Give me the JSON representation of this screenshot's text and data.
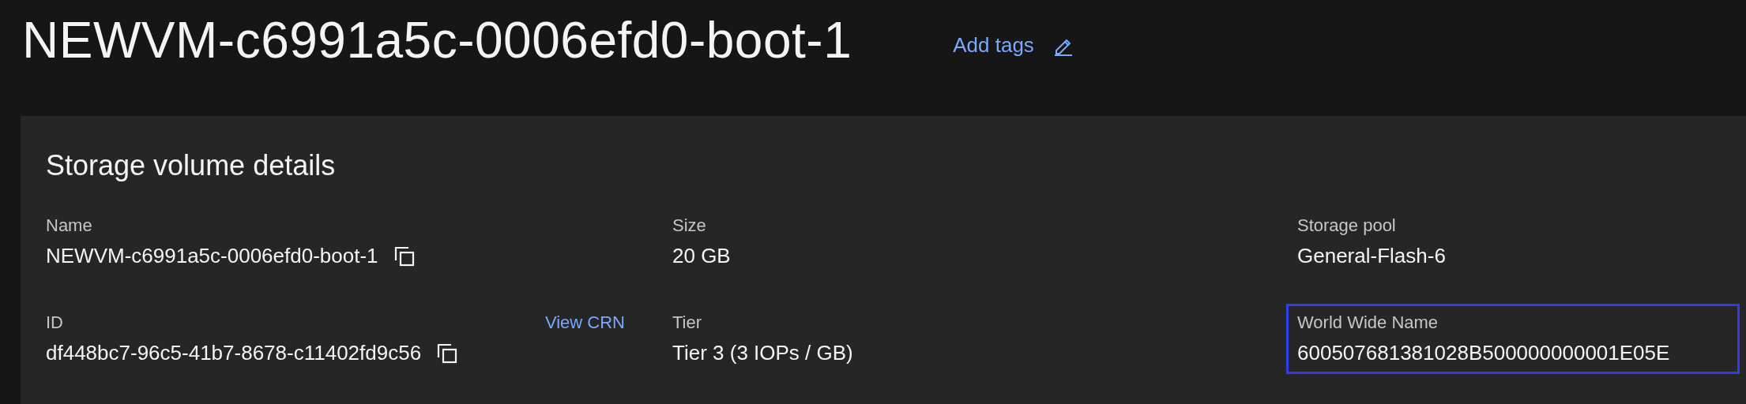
{
  "header": {
    "title": "NEWVM-c6991a5c-0006efd0-boot-1",
    "tags_link": "Add tags"
  },
  "panel": {
    "title": "Storage volume details",
    "fields": [
      {
        "label": "Name",
        "value": "NEWVM-c6991a5c-0006efd0-boot-1",
        "copyable": true,
        "highlighted": false
      },
      {
        "label": "Size",
        "value": "20 GB",
        "copyable": false,
        "highlighted": false
      },
      {
        "label": "Storage pool",
        "value": "General-Flash-6",
        "copyable": false,
        "highlighted": false
      },
      {
        "label": "ID",
        "value": "df448bc7-96c5-41b7-8678-c11402fd9c56",
        "copyable": true,
        "highlighted": false,
        "link": "View CRN"
      },
      {
        "label": "Tier",
        "value": "Tier 3 (3 IOPs / GB)",
        "copyable": false,
        "highlighted": false
      },
      {
        "label": "World Wide Name",
        "value": "600507681381028B500000000001E05E",
        "copyable": false,
        "highlighted": true
      }
    ]
  }
}
